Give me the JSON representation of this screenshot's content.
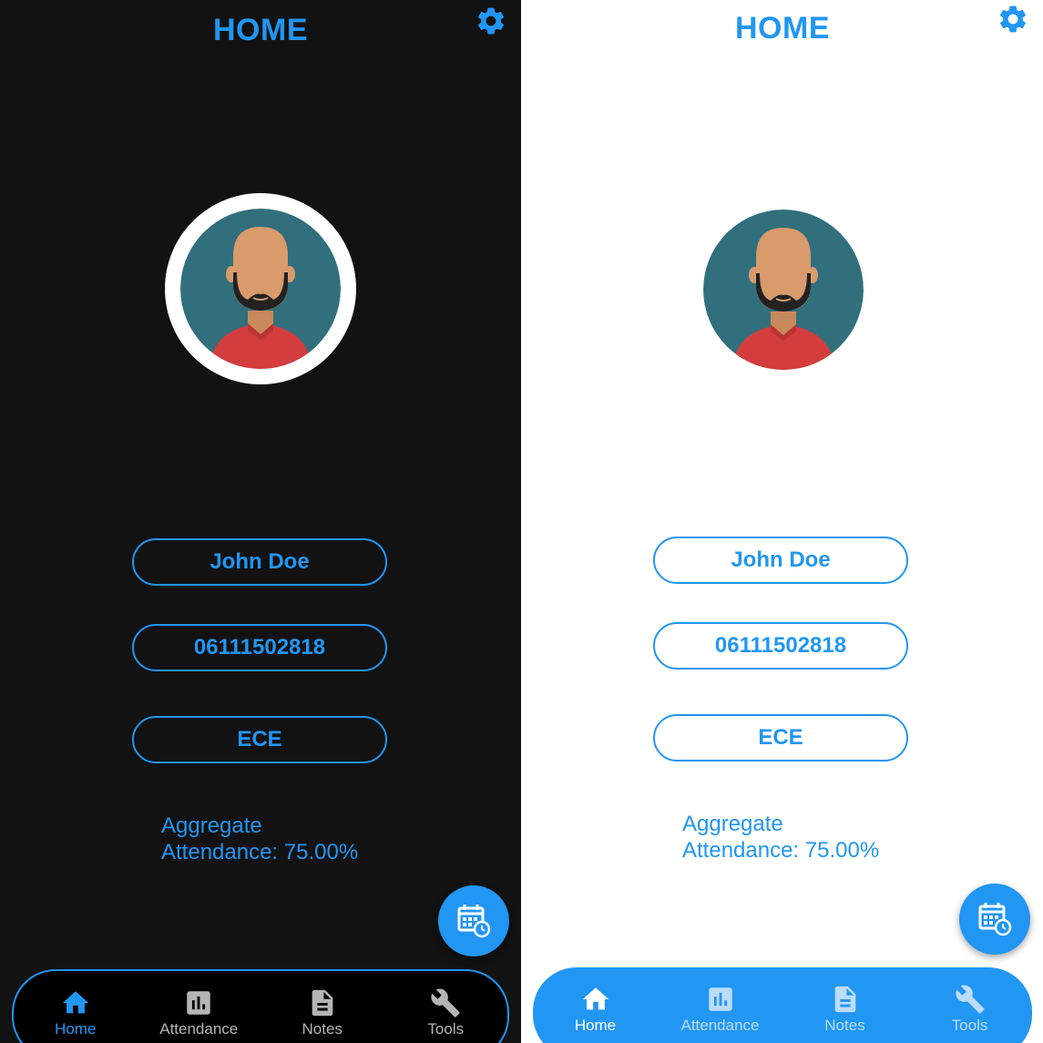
{
  "colors": {
    "accent": "#2196f3",
    "dark_background": "#121212",
    "light_background": "#ffffff",
    "avatar_bg": "#316f7d",
    "shirt": "#d33d3d",
    "skin": "#d99a6c",
    "beard": "#222222"
  },
  "screens": [
    {
      "theme": "dark",
      "header": {
        "title": "HOME",
        "settings_icon": "gear-icon"
      },
      "profile": {
        "avatar_icon": "avatar-man-icon",
        "name": "John Doe",
        "id": "06111502818",
        "branch": "ECE",
        "aggregate_line1": "Aggregate",
        "aggregate_line2": "Attendance: 75.00%"
      },
      "fab": {
        "icon": "calendar-clock-icon"
      },
      "nav": [
        {
          "label": "Home",
          "icon": "home-icon",
          "active": true
        },
        {
          "label": "Attendance",
          "icon": "bar-chart-icon",
          "active": false
        },
        {
          "label": "Notes",
          "icon": "document-icon",
          "active": false
        },
        {
          "label": "Tools",
          "icon": "wrench-icon",
          "active": false
        }
      ]
    },
    {
      "theme": "light",
      "header": {
        "title": "HOME",
        "settings_icon": "gear-icon"
      },
      "profile": {
        "avatar_icon": "avatar-man-icon",
        "name": "John Doe",
        "id": "06111502818",
        "branch": "ECE",
        "aggregate_line1": "Aggregate",
        "aggregate_line2": "Attendance: 75.00%"
      },
      "fab": {
        "icon": "calendar-clock-icon"
      },
      "nav": [
        {
          "label": "Home",
          "icon": "home-icon",
          "active": true
        },
        {
          "label": "Attendance",
          "icon": "bar-chart-icon",
          "active": false
        },
        {
          "label": "Notes",
          "icon": "document-icon",
          "active": false
        },
        {
          "label": "Tools",
          "icon": "wrench-icon",
          "active": false
        }
      ]
    }
  ]
}
